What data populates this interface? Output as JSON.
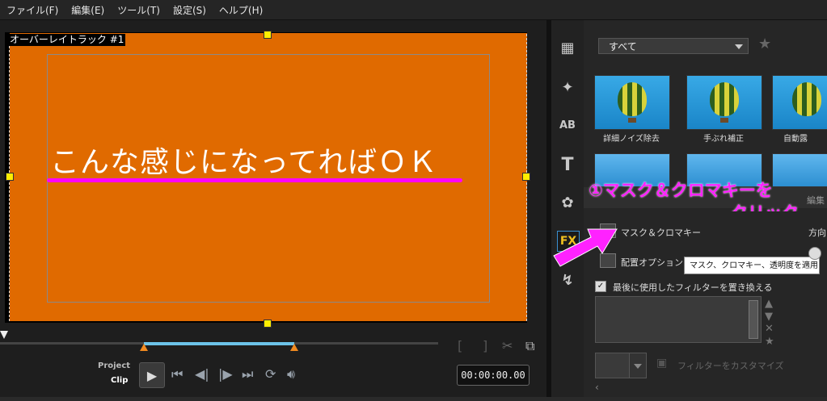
{
  "menu": [
    "ファイル(F)",
    "編集(E)",
    "ツール(T)",
    "設定(S)",
    "ヘルプ(H)"
  ],
  "preview": {
    "overlay_label": "オーバーレイトラック #1",
    "caption": "こんな感じになってればＯＫ"
  },
  "playback": {
    "project_label": "Project",
    "clip_label": "Clip",
    "timecode": "00:00:00.00",
    "icons": [
      "play-icon",
      "go-start-icon",
      "prev-frame-icon",
      "next-frame-icon",
      "go-end-icon",
      "loop-icon",
      "volume-icon",
      "mark-in-icon",
      "mark-out-icon",
      "split-icon",
      "copy-icon"
    ]
  },
  "library": {
    "filter_dropdown": "すべて",
    "category_icons": [
      "media-icon",
      "instant-project-icon",
      "transition-icon",
      "title-icon",
      "graphic-icon",
      "fx-filter-icon",
      "path-icon"
    ],
    "thumbnails": [
      {
        "label": "詳細ノイズ除去"
      },
      {
        "label": "手ぶれ補正"
      },
      {
        "label": "自動露"
      }
    ],
    "tab_label": "編集"
  },
  "options": {
    "annotation_line1": "①マスク＆クロマキーを",
    "annotation_line2": "クリック",
    "mask_chroma_label": "マスク＆クロマキー",
    "direction_label": "方向",
    "placement_label": "配置オプション",
    "tooltip": "マスク、クロマキー、透明度を適用",
    "replace_filter_label": "最後に使用したフィルターを置き換える",
    "replace_filter_checked": true,
    "customize_filter_label": "フィルターをカスタマイズ"
  },
  "colors": {
    "video_bg": "#e06a00",
    "annotation": "#ff22ff",
    "accent_blue": "#6cc3e8"
  }
}
